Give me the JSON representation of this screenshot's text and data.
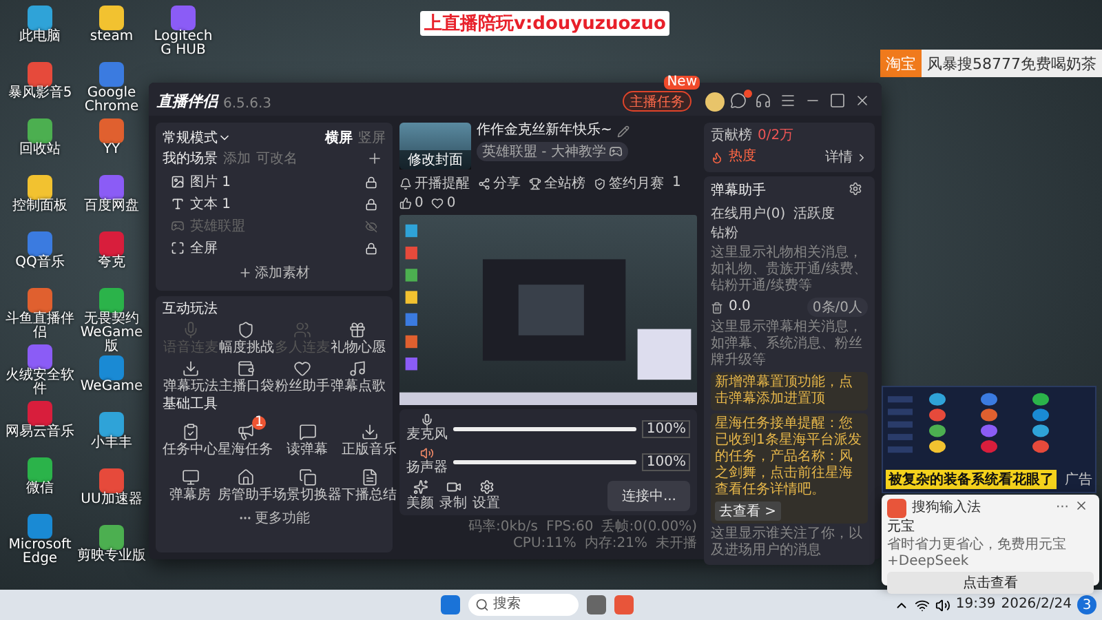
{
  "desktop": {
    "caption": "上直播陪玩v:douyuzuozuo",
    "ad_banner": {
      "tag": "淘宝",
      "text": "风暴搜58777免费喝奶茶"
    },
    "icon_columns": [
      [
        "此电脑",
        "暴风影音5",
        "回收站",
        "控制面板",
        "QQ音乐",
        "斗鱼直播伴侣",
        "火绒安全软件",
        "网易云音乐",
        "微信",
        "Microsoft Edge"
      ],
      [
        "steam",
        "Google Chrome",
        "YY",
        "百度网盘",
        "夸克",
        "无畏契约WeGame版",
        "WeGame",
        "小丰丰",
        "UU加速器",
        "剪映专业版"
      ],
      [
        "Logitech G HUB"
      ]
    ]
  },
  "app": {
    "name": "直播伴侣",
    "version": "6.5.6.3",
    "task_button": "主播任务",
    "task_badge": "New",
    "mode": {
      "label": "常规模式",
      "options": [
        {
          "label": "横屏",
          "selected": true
        },
        {
          "label": "竖屏",
          "selected": false
        }
      ]
    },
    "scenes": {
      "title": "我的场景",
      "links": [
        "添加",
        "可改名"
      ],
      "items": [
        {
          "label": "图片 1",
          "visible": true
        },
        {
          "label": "文本 1",
          "visible": true
        },
        {
          "label": "英雄联盟",
          "visible": false
        },
        {
          "label": "全屏",
          "visible": true
        }
      ],
      "add_label": "添加素材"
    },
    "tool_sections": [
      {
        "title": "互动玩法",
        "items": [
          {
            "label": "语音连麦",
            "disabled": true
          },
          {
            "label": "幅度挑战",
            "disabled": false
          },
          {
            "label": "多人连麦",
            "disabled": true
          },
          {
            "label": "礼物心愿",
            "disabled": false
          },
          {
            "label": "弹幕玩法",
            "disabled": false
          },
          {
            "label": "主播口袋",
            "disabled": false
          },
          {
            "label": "粉丝助手",
            "disabled": false
          },
          {
            "label": "弹幕点歌",
            "disabled": false
          }
        ]
      },
      {
        "title": "基础工具",
        "items": [
          {
            "label": "任务中心",
            "disabled": false
          },
          {
            "label": "星海任务",
            "disabled": false,
            "badge": "1"
          },
          {
            "label": "读弹幕",
            "disabled": false
          },
          {
            "label": "正版音乐",
            "disabled": false
          },
          {
            "label": "弹幕房",
            "disabled": false
          },
          {
            "label": "房管助手",
            "disabled": false
          },
          {
            "label": "场景切换器",
            "disabled": false
          },
          {
            "label": "下播总结",
            "disabled": false
          }
        ]
      }
    ],
    "more": "更多功能",
    "stream": {
      "cover_label": "修改封面",
      "title": "作作金克丝新年快乐~",
      "category": "英雄联盟 - 大神教学",
      "remind": "开播提醒",
      "share": "分享",
      "rank": "全站榜",
      "contract": "签约月赛",
      "contract_count": "1",
      "likes": "0",
      "hearts": "0"
    },
    "audio": [
      {
        "kind": "mic",
        "name": "麦克风",
        "level": 1,
        "reading": "100%"
      },
      {
        "kind": "speaker",
        "name": "扬声器",
        "level": 1,
        "reading": "100%"
      }
    ],
    "actions": [
      "美颜",
      "录制",
      "设置"
    ],
    "connect_button": "连接中...",
    "status": [
      "码率:0kb/s",
      "FPS:60",
      "丢帧:0(0.00%)",
      "CPU:11%",
      "内存:21%",
      "未开播"
    ],
    "side": {
      "rank_title": "贡献榜",
      "rank_value": "0/2万",
      "heat": "热度",
      "details": "详情",
      "helper_title": "弹幕助手",
      "tabs": [
        "在线用户(0)",
        "活跃度",
        "钻粉"
      ],
      "gift_hint": "这里显示礼物相关消息，如礼物、贵族开通/续费、钻粉开通/续费等",
      "gift_value": "0.0",
      "count_badge": "0条/0人",
      "danmu_hint": "这里显示弹幕相关消息，如弹幕、系统消息、粉丝牌升级等",
      "notices": [
        "新增弹幕置顶功能，点击弹幕添加进置顶",
        "星海任务接单提醒：您已收到1条星海平台派发的任务，产品名称：风之剑舞，点击前往星海查看任务详情吧。"
      ],
      "notice_button": "去查看 >",
      "follow_hint": "这里显示谁关注了你，以及进场用户的消息"
    }
  },
  "game_ad": {
    "caption": "被复杂的装备系统看花眼了",
    "ad_label": "广告"
  },
  "notification": {
    "app": "搜狗输入法",
    "more": "···",
    "title": "元宝",
    "body": "省时省力更省心，免费用元宝+DeepSeek",
    "button": "点击查看"
  },
  "taskbar": {
    "search_placeholder": "搜索",
    "time": "19:39",
    "date": "2026/2/24",
    "badge": "3"
  }
}
